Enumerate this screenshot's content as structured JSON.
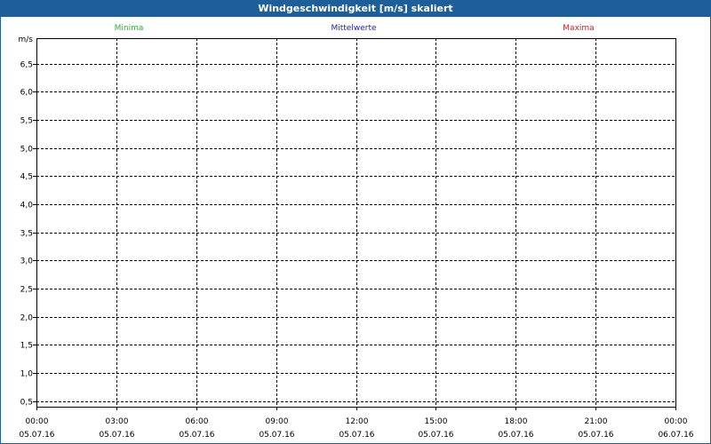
{
  "window": {
    "title": "Windgeschwindigkeit [m/s] skaliert"
  },
  "colors": {
    "title_bar": "#1f5f99",
    "minima": "#22bb22",
    "mittelwerte": "#2222cc",
    "maxima": "#cc2222"
  },
  "chart_data": {
    "type": "line",
    "title": "Windgeschwindigkeit [m/s] skaliert",
    "ylabel": "m/s",
    "xlabel": "",
    "ylim": [
      0.4,
      6.95
    ],
    "y_ticks": [
      "0,5",
      "1,0",
      "1,5",
      "2,0",
      "2,5",
      "3,0",
      "3,5",
      "4,0",
      "4,5",
      "5,0",
      "5,5",
      "6,0",
      "6,5"
    ],
    "y_tick_values": [
      0.5,
      1.0,
      1.5,
      2.0,
      2.5,
      3.0,
      3.5,
      4.0,
      4.5,
      5.0,
      5.5,
      6.0,
      6.5
    ],
    "x_ticks": [
      {
        "time": "00:00",
        "date": "05.07.16"
      },
      {
        "time": "03:00",
        "date": "05.07.16"
      },
      {
        "time": "06:00",
        "date": "05.07.16"
      },
      {
        "time": "09:00",
        "date": "05.07.16"
      },
      {
        "time": "12:00",
        "date": "05.07.16"
      },
      {
        "time": "15:00",
        "date": "05.07.16"
      },
      {
        "time": "18:00",
        "date": "05.07.16"
      },
      {
        "time": "21:00",
        "date": "05.07.16"
      },
      {
        "time": "00:00",
        "date": "06.07.16"
      }
    ],
    "legend_placement": "top",
    "grid": true,
    "series": [
      {
        "name": "Minima",
        "values": []
      },
      {
        "name": "Mittelwerte",
        "values": []
      },
      {
        "name": "Maxima",
        "values": []
      }
    ]
  }
}
